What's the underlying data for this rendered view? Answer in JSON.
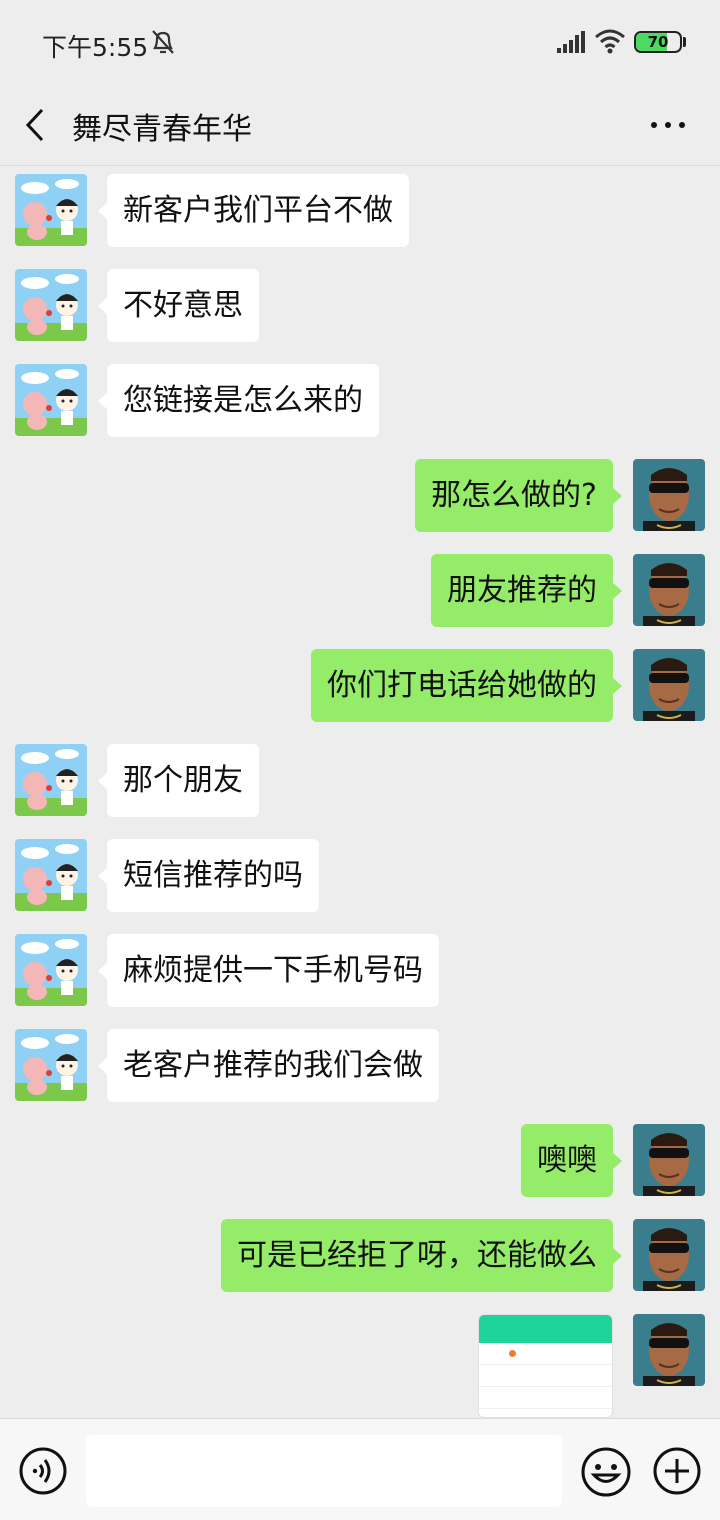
{
  "status_bar": {
    "time": "下午5:55",
    "battery": "70",
    "battery_level_percent": 70,
    "icons": [
      "mute-icon",
      "signal-icon",
      "wifi-icon",
      "battery-icon"
    ]
  },
  "header": {
    "title": "舞尽青春年华",
    "back_icon": "chevron-left-icon",
    "more_icon": "more-dots-icon"
  },
  "messages": [
    {
      "side": "left",
      "text": "新客户我们平台不做"
    },
    {
      "side": "left",
      "text": "不好意思"
    },
    {
      "side": "left",
      "text": "您链接是怎么来的"
    },
    {
      "side": "right",
      "text": "那怎么做的?"
    },
    {
      "side": "right",
      "text": "朋友推荐的"
    },
    {
      "side": "right",
      "text": "你们打电话给她做的"
    },
    {
      "side": "left",
      "text": "那个朋友"
    },
    {
      "side": "left",
      "text": "短信推荐的吗"
    },
    {
      "side": "left",
      "text": "麻烦提供一下手机号码"
    },
    {
      "side": "left",
      "text": "老客户推荐的我们会做"
    },
    {
      "side": "right",
      "text": "噢噢"
    },
    {
      "side": "right",
      "text": "可是已经拒了呀，还能做么"
    },
    {
      "side": "right",
      "type": "image",
      "text": ""
    }
  ],
  "colors": {
    "background": "#ededed",
    "sent_bubble": "#95ec69",
    "received_bubble": "#ffffff",
    "battery_fill": "#4cd964"
  },
  "input_bar": {
    "voice_icon": "voice-icon",
    "emoji_icon": "emoji-icon",
    "plus_icon": "plus-icon",
    "placeholder": ""
  }
}
